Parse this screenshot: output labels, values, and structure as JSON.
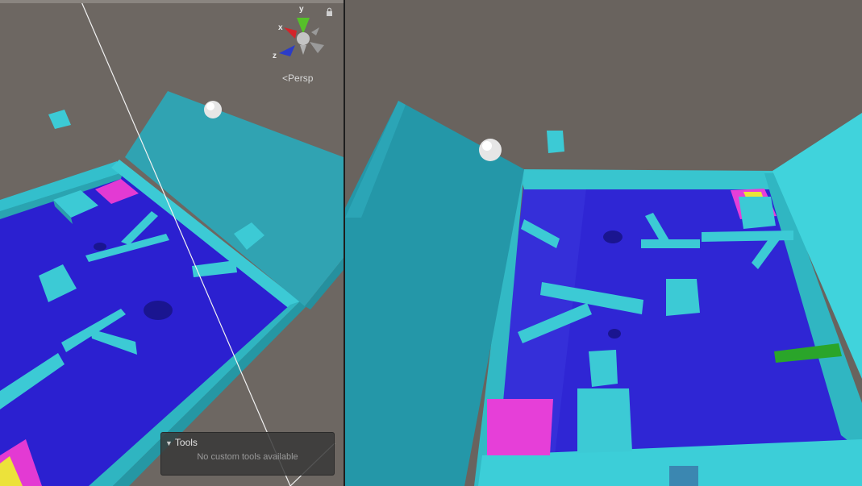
{
  "scene_view": {
    "gizmo": {
      "x_label": "x",
      "y_label": "y",
      "z_label": "z"
    },
    "projection_label": "Persp",
    "tools_panel": {
      "title": "Tools",
      "message": "No custom tools available"
    }
  },
  "colors": {
    "background": "#6b6560",
    "board_floor": "#2b20d0",
    "board_wall": "#38c5cf",
    "lid_panel": "#2a9fb0",
    "goal_pad": "#e33ad3",
    "yellow_pad": "#f0e020",
    "green_bar": "#2aa52a",
    "ball": "#e6e6e6"
  }
}
